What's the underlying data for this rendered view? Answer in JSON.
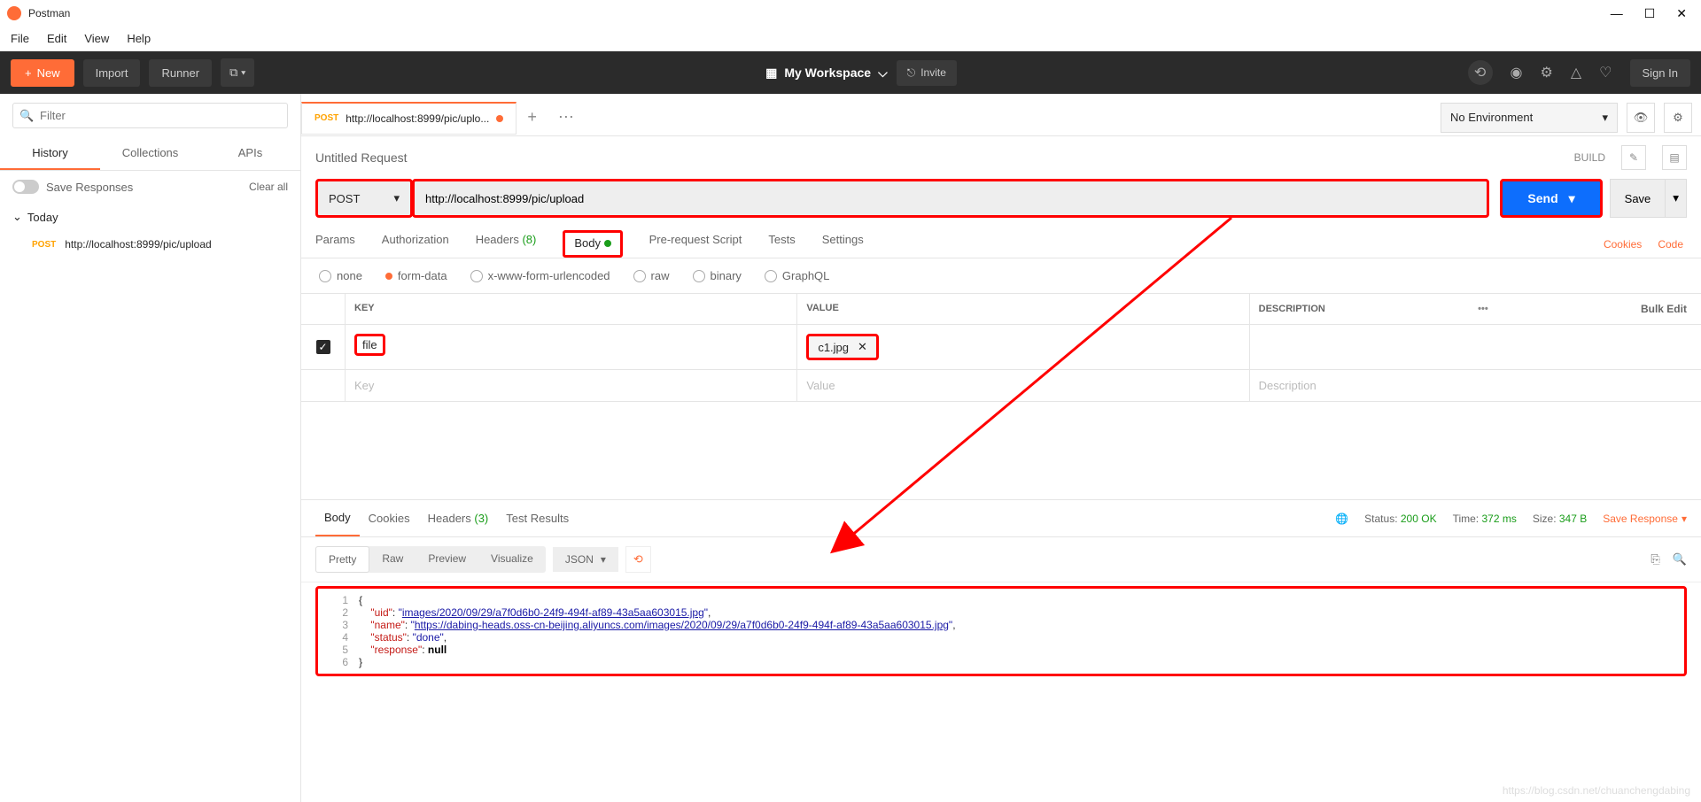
{
  "titlebar": {
    "app_name": "Postman"
  },
  "menubar": {
    "file": "File",
    "edit": "Edit",
    "view": "View",
    "help": "Help"
  },
  "toolbar": {
    "new": "New",
    "import": "Import",
    "runner": "Runner",
    "workspace": "My Workspace",
    "invite": "Invite",
    "signin": "Sign In"
  },
  "sidebar": {
    "filter_placeholder": "Filter",
    "tabs": {
      "history": "History",
      "collections": "Collections",
      "apis": "APIs"
    },
    "save_responses": "Save Responses",
    "clear_all": "Clear all",
    "today": "Today",
    "history_item": {
      "method": "POST",
      "url": "http://localhost:8999/pic/upload"
    }
  },
  "request": {
    "tab_method": "POST",
    "tab_title": "http://localhost:8999/pic/uplo...",
    "name": "Untitled Request",
    "build": "BUILD",
    "method": "POST",
    "url": "http://localhost:8999/pic/upload",
    "send": "Send",
    "save": "Save",
    "section_tabs": {
      "params": "Params",
      "auth": "Authorization",
      "headers": "Headers",
      "headers_cnt": "(8)",
      "body": "Body",
      "prereq": "Pre-request Script",
      "tests": "Tests",
      "settings": "Settings"
    },
    "cookies": "Cookies",
    "code": "Code",
    "body_types": {
      "none": "none",
      "formdata": "form-data",
      "xwww": "x-www-form-urlencoded",
      "raw": "raw",
      "binary": "binary",
      "graphql": "GraphQL"
    },
    "kv_headers": {
      "key": "KEY",
      "value": "VALUE",
      "desc": "DESCRIPTION",
      "bulk": "Bulk Edit"
    },
    "kv_rows": [
      {
        "key": "file",
        "value": "c1.jpg"
      }
    ],
    "key_ph": "Key",
    "val_ph": "Value",
    "desc_ph": "Description"
  },
  "env": {
    "label": "No Environment"
  },
  "response": {
    "tabs": {
      "body": "Body",
      "cookies": "Cookies",
      "headers": "Headers",
      "headers_cnt": "(3)",
      "test": "Test Results"
    },
    "status_label": "Status:",
    "status_value": "200 OK",
    "time_label": "Time:",
    "time_value": "372 ms",
    "size_label": "Size:",
    "size_value": "347 B",
    "save_resp": "Save Response",
    "views": {
      "pretty": "Pretty",
      "raw": "Raw",
      "preview": "Preview",
      "visualize": "Visualize"
    },
    "format": "JSON",
    "json_body": {
      "uid": "images/2020/09/29/a7f0d6b0-24f9-494f-af89-43a5aa603015.jpg",
      "name": "https://dabing-heads.oss-cn-beijing.aliyuncs.com/images/2020/09/29/a7f0d6b0-24f9-494f-af89-43a5aa603015.jpg",
      "status": "done",
      "response": "null"
    }
  },
  "watermark": "https://blog.csdn.net/chuanchengdabing"
}
